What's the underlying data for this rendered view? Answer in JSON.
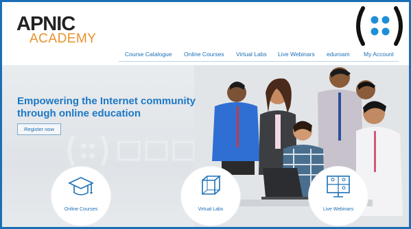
{
  "header": {
    "logo_primary": "APNIC",
    "logo_secondary": "ACADEMY",
    "brand_mark_icon": "apnic-dots-logo-icon"
  },
  "nav": {
    "items": [
      {
        "label": "Course Catalogue"
      },
      {
        "label": "Online Courses"
      },
      {
        "label": "Virtual Labs"
      },
      {
        "label": "Live Webinars"
      },
      {
        "label": "eduroam"
      },
      {
        "label": "My Account"
      }
    ]
  },
  "hero": {
    "title": "Empowering the Internet community through online education",
    "register_label": "Register now"
  },
  "features": [
    {
      "label": "Online Courses",
      "icon": "graduation-cap-icon"
    },
    {
      "label": "Virtual Labs",
      "icon": "cube-icon"
    },
    {
      "label": "Live Webinars",
      "icon": "webinar-screen-icon"
    }
  ],
  "colors": {
    "frame": "#1a6fb5",
    "link": "#1a6fb5",
    "accent_orange": "#e8912a",
    "title_blue": "#1b78c4"
  }
}
